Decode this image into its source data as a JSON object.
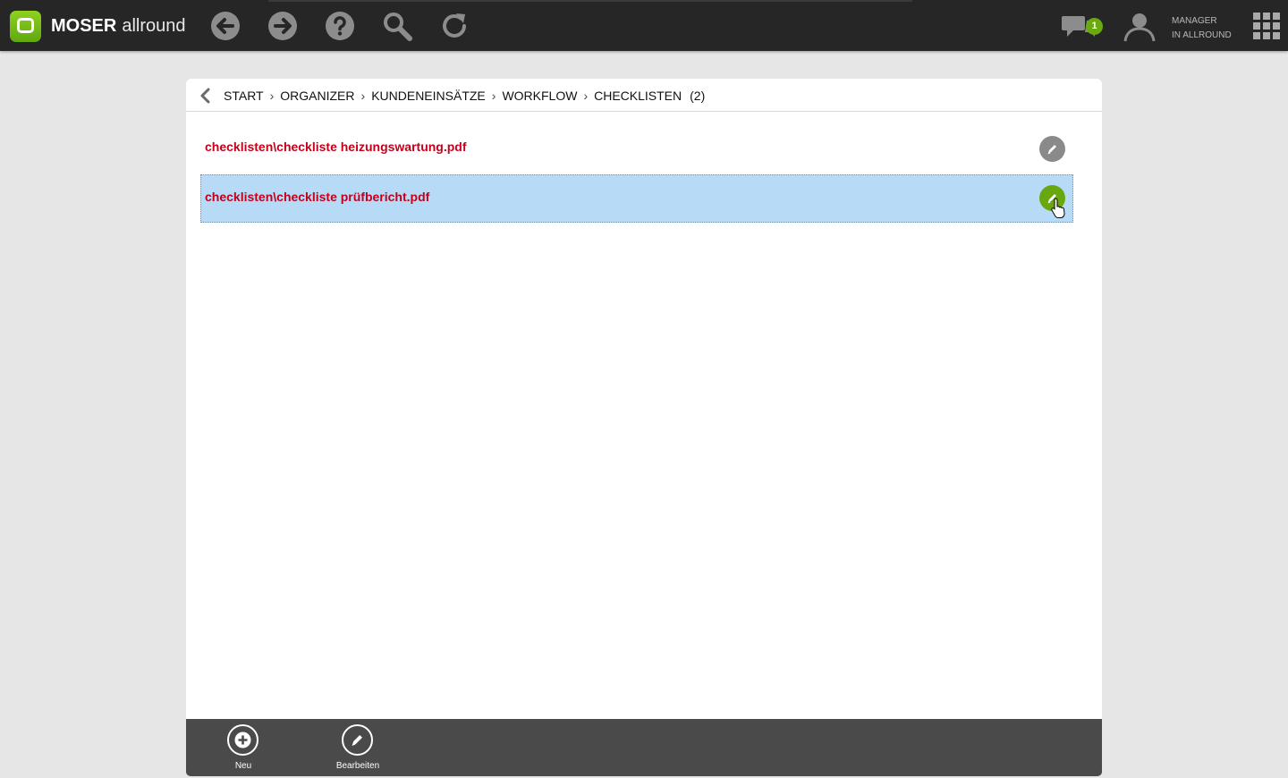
{
  "app": {
    "brand_bold": "MOSER",
    "brand_light": "allround",
    "logo_icon": "speech-bubble-logo-icon",
    "accent_color": "#6aa90f"
  },
  "toolbar": {
    "icons": [
      "back-arrow-icon",
      "forward-arrow-icon",
      "help-icon",
      "search-icon",
      "refresh-icon"
    ],
    "notifications_count": "1",
    "user_line1": "MANAGER",
    "user_line2": "IN ALLROUND"
  },
  "breadcrumb": {
    "items": [
      "START",
      "ORGANIZER",
      "KUNDENEINSÄTZE",
      "WORKFLOW",
      "CHECKLISTEN"
    ],
    "separator": "›",
    "count": "(2)"
  },
  "list": {
    "items": [
      {
        "label": "checklisten\\checkliste heizungswartung.pdf",
        "selected": false,
        "action_color": "#8a8a8a"
      },
      {
        "label": "checklisten\\checkliste prüfbericht.pdf",
        "selected": true,
        "action_color": "#69a70f"
      }
    ]
  },
  "bottom_actions": {
    "new_label": "Neu",
    "edit_label": "Bearbeiten"
  }
}
